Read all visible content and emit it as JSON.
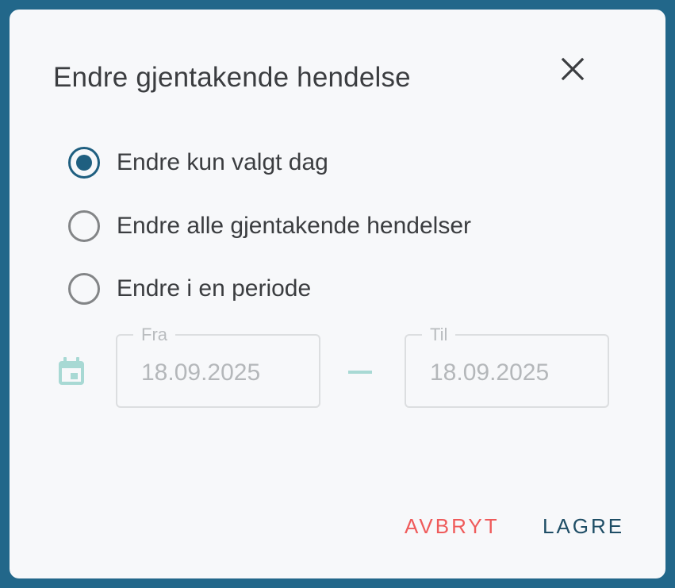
{
  "dialog": {
    "title": "Endre gjentakende hendelse",
    "options": [
      {
        "label": "Endre kun valgt dag",
        "checked": true
      },
      {
        "label": "Endre alle gjentakende hendelser",
        "checked": false
      },
      {
        "label": "Endre i en periode",
        "checked": false
      }
    ],
    "period": {
      "from_label": "Fra",
      "from_value": "18.09.2025",
      "to_label": "Til",
      "to_value": "18.09.2025"
    },
    "actions": {
      "cancel_label": "AVBRYT",
      "save_label": "LAGRE"
    }
  },
  "colors": {
    "backdrop": "#22678a",
    "radio_checked": "#1f5f80",
    "cancel": "#ef5b5b",
    "save": "#1f4e66",
    "calendar_icon": "#a8d9d4"
  },
  "icons": [
    "close-icon",
    "calendar-icon"
  ]
}
